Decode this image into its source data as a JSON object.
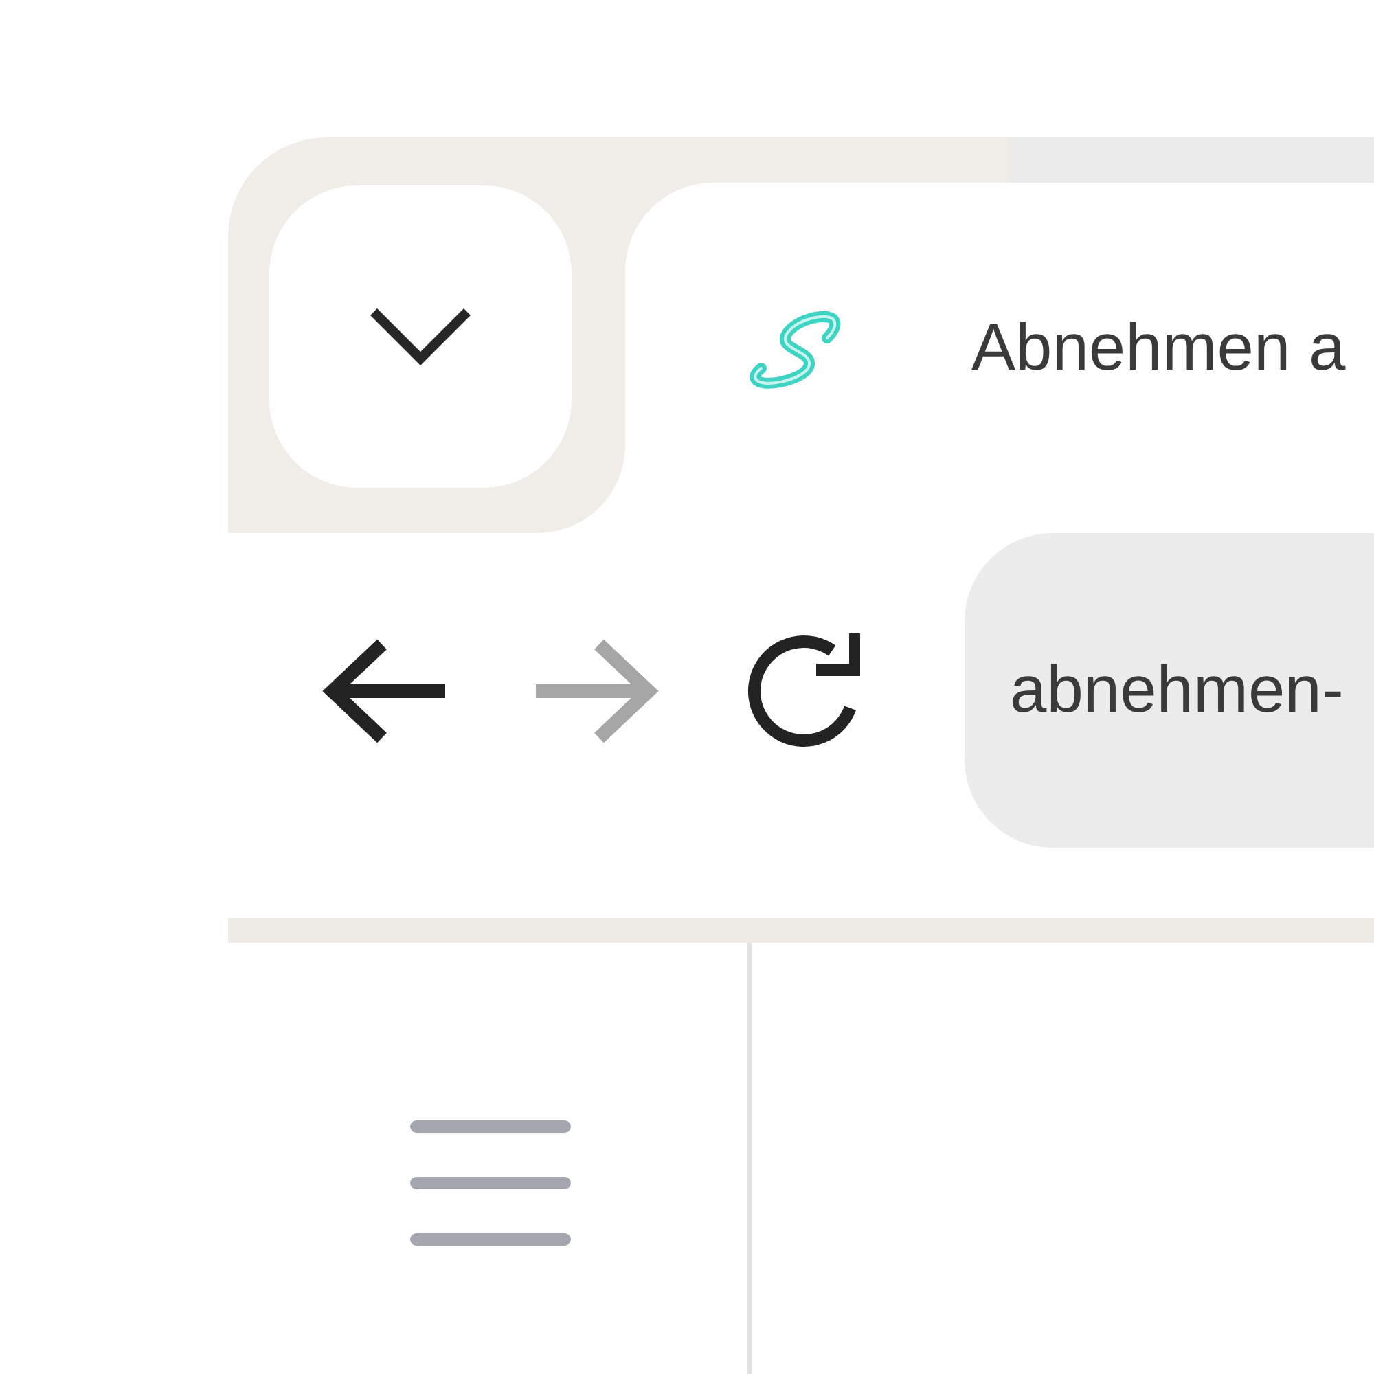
{
  "tab_strip": {
    "tabs": [
      {
        "title": "Abnehmen a",
        "selected": true
      }
    ]
  },
  "toolbar": {
    "back": {
      "disabled": false
    },
    "forward": {
      "disabled": true
    },
    "address_bar": {
      "value": "abnehmen-"
    }
  }
}
